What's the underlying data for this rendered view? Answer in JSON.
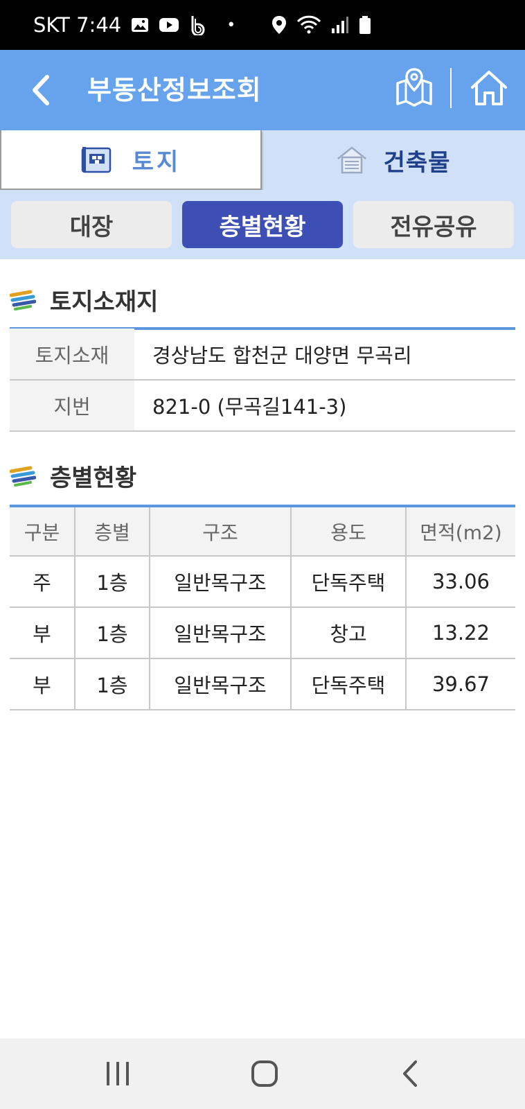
{
  "status_bar": {
    "carrier_time": "SKT 7:44",
    "dot": "•"
  },
  "header": {
    "title": "부동산정보조회"
  },
  "main_tabs": [
    {
      "label": "토지",
      "icon": "map-book-icon"
    },
    {
      "label": "건축물",
      "icon": "house-icon"
    }
  ],
  "sub_tabs": [
    {
      "label": "대장"
    },
    {
      "label": "층별현황"
    },
    {
      "label": "전유공유"
    }
  ],
  "location_section": {
    "title": "토지소재지",
    "rows": [
      {
        "label": "토지소재",
        "value": "경상남도 합천군 대양면 무곡리"
      },
      {
        "label": "지번",
        "value": "821-0 (무곡길141-3)"
      }
    ]
  },
  "floor_section": {
    "title": "층별현황",
    "columns": [
      "구분",
      "층별",
      "구조",
      "용도",
      "면적(m2)"
    ],
    "rows": [
      [
        "주",
        "1층",
        "일반목구조",
        "단독주택",
        "33.06"
      ],
      [
        "부",
        "1층",
        "일반목구조",
        "창고",
        "13.22"
      ],
      [
        "부",
        "1층",
        "일반목구조",
        "단독주택",
        "39.67"
      ]
    ]
  },
  "colors": {
    "header_bg": "#66a3ec",
    "tab_bar_bg": "#cfe0f7",
    "active_sub_tab": "#3d4fb5",
    "rule": "#5b95e0"
  }
}
